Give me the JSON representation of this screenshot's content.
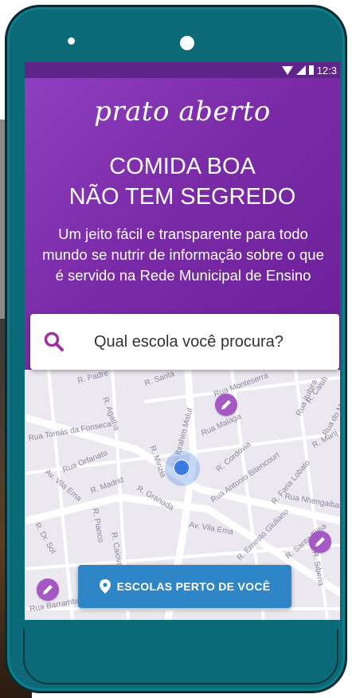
{
  "status_bar": {
    "time": "12:3"
  },
  "hero": {
    "logo": "prato aberto",
    "headline_line1": "COMIDA BOA",
    "headline_line2": "NÃO TEM SEGREDO",
    "subtitle_line1": "Um jeito fácil e transparente para todo",
    "subtitle_line2": "mundo se nutrir de informação sobre o que",
    "subtitle_line3": "é servido na Rede Municipal de Ensino"
  },
  "search": {
    "placeholder": "Qual escola você procura?",
    "icon": "search-icon"
  },
  "map": {
    "streets": [
      "R. Padre",
      "R. Santa",
      "Rua Monteserra",
      "R. Caiub",
      "R. Agatha",
      "Rua Tomás da Fonseca",
      "Rua Orfanato",
      "R. Madrid",
      "Av. Vila Ema",
      "R. Mirizia",
      "Rua Malaga",
      "R. Cordovia",
      "Rua Antonio Bitencourt",
      "R. Granada",
      "Av. Ibrahim Maluf",
      "R. Faria Lobato",
      "R. Dr. Sol",
      "R. Ernesto Giuliano",
      "R. Santa Elisa",
      "Rua Nhengaibas",
      "Av. Vila Ema",
      "Rua Itubira",
      "R. Manj",
      "Rua do Mor",
      "R. Pianco",
      "R. Caiovar",
      "Rua Barramba",
      "R. Siberia"
    ],
    "school_pins": 3,
    "pin_icon": "pencil-icon",
    "location_marker": "current-location-icon"
  },
  "nearby_button": {
    "label": "ESCOLAS PERTO DE VOCÊ",
    "icon": "map-pin-icon"
  },
  "colors": {
    "purple": "#7a2aa6",
    "button_blue": "#2e86c6",
    "pin_purple": "#a557c4",
    "phone_teal": "#0c6a78"
  }
}
